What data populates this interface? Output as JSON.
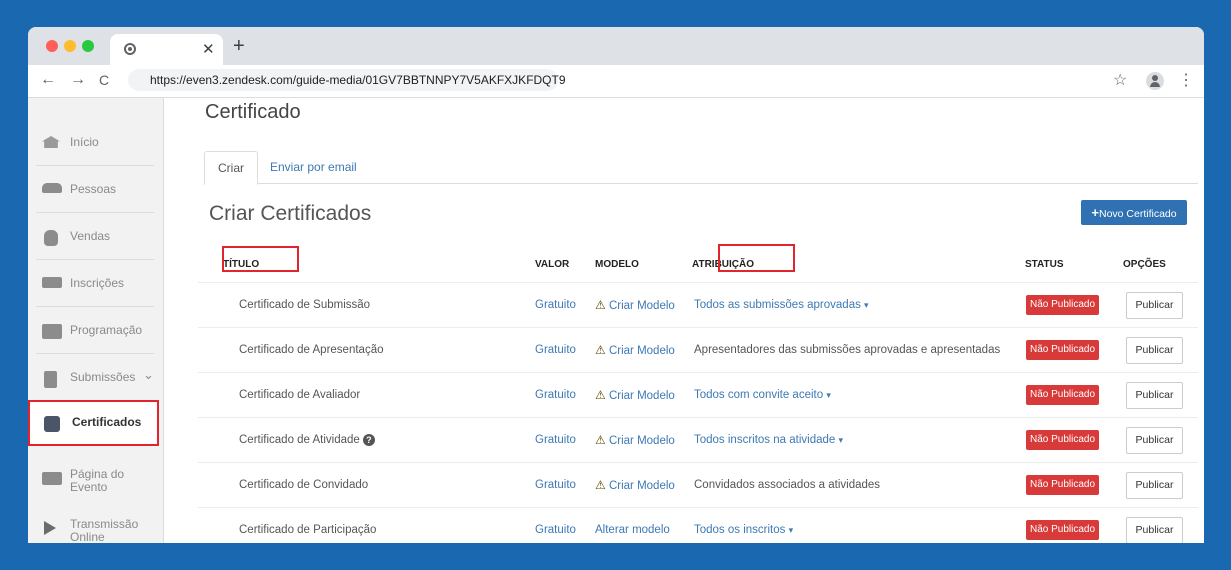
{
  "browser": {
    "url": "https://even3.zendesk.com/guide-media/01GV7BBTNNPY7V5AKFXJKFDQT9",
    "close_glyph": "✕",
    "new_tab_glyph": "+",
    "back_glyph": "←",
    "forward_glyph": "→",
    "reload_glyph": "C",
    "star_glyph": "☆",
    "menu_glyph": "⋮"
  },
  "sidebar": {
    "items": [
      {
        "label": "Início",
        "icon": "home-icon"
      },
      {
        "label": "Pessoas",
        "icon": "people-icon"
      },
      {
        "label": "Vendas",
        "icon": "money-bag-icon"
      },
      {
        "label": "Inscrições",
        "icon": "ticket-icon"
      },
      {
        "label": "Programação",
        "icon": "calendar-icon"
      },
      {
        "label": "Submissões",
        "icon": "document-icon",
        "chevron": "⌄"
      },
      {
        "label": "Certificados",
        "icon": "certificate-icon"
      },
      {
        "label": "Página do Evento",
        "icon": "web-page-icon"
      },
      {
        "label": "Transmissão Online",
        "icon": "play-icon"
      }
    ]
  },
  "main": {
    "page_title": "Certificado",
    "tabs": [
      {
        "label": "Criar"
      },
      {
        "label": "Enviar por email"
      }
    ],
    "section_title": "Criar Certificados",
    "new_button": {
      "plus": "+",
      "label": "Novo Certificado"
    },
    "columns": {
      "titulo": "TÍTULO",
      "valor": "VALOR",
      "modelo": "MODELO",
      "atribuicao": "ATRIBUIÇÃO",
      "status": "STATUS",
      "opcoes": "OPÇÕES"
    },
    "rows": [
      {
        "titulo": "Certificado de Submissão",
        "valor": "Gratuito",
        "modelo_warn": "⚠",
        "modelo": "Criar Modelo",
        "atribuicao": "Todos as submissões aprovadas",
        "atribuicao_caret": "▾",
        "status": "Não Publicado",
        "acao": "Publicar"
      },
      {
        "titulo": "Certificado de Apresentação",
        "valor": "Gratuito",
        "modelo_warn": "⚠",
        "modelo": "Criar Modelo",
        "atribuicao": "Apresentadores das submissões aprovadas e apresentadas",
        "atribuicao_caret": "",
        "status": "Não Publicado",
        "acao": "Publicar"
      },
      {
        "titulo": "Certificado de Avaliador",
        "valor": "Gratuito",
        "modelo_warn": "⚠",
        "modelo": "Criar Modelo",
        "atribuicao": "Todos com convite aceito",
        "atribuicao_caret": "▾",
        "status": "Não Publicado",
        "acao": "Publicar"
      },
      {
        "titulo": "Certificado de Atividade",
        "help": "?",
        "valor": "Gratuito",
        "modelo_warn": "⚠",
        "modelo": "Criar Modelo",
        "atribuicao": "Todos inscritos na atividade",
        "atribuicao_caret": "▾",
        "status": "Não Publicado",
        "acao": "Publicar"
      },
      {
        "titulo": "Certificado de Convidado",
        "valor": "Gratuito",
        "modelo_warn": "⚠",
        "modelo": "Criar Modelo",
        "atribuicao": "Convidados associados a atividades",
        "atribuicao_caret": "",
        "status": "Não Publicado",
        "acao": "Publicar"
      },
      {
        "titulo": "Certificado de Participação",
        "valor": "Gratuito",
        "modelo_warn": "",
        "modelo": "Alterar modelo",
        "atribuicao": "Todos os inscritos",
        "atribuicao_caret": "▾",
        "status": "Não Publicado",
        "acao": "Publicar"
      }
    ]
  },
  "colors": {
    "background": "#1a68b0",
    "accent": "#2f71b3",
    "badge": "#d83a3a",
    "highlight": "#e2252c"
  }
}
